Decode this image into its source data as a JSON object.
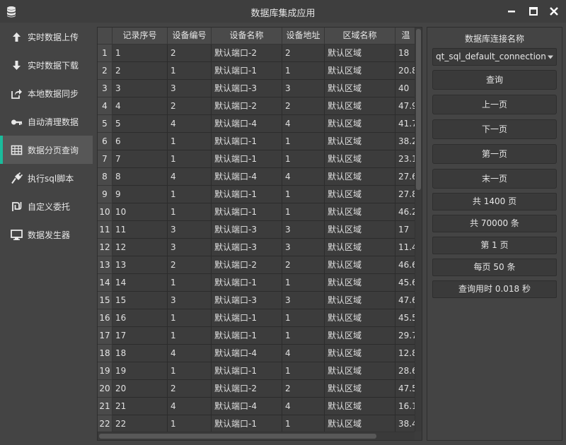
{
  "window": {
    "title": "数据库集成应用",
    "app_icon": "database-icon"
  },
  "colors": {
    "accent": "#1abc9c",
    "background": "#444444",
    "cell": "#3c3c3c",
    "header": "#4a4a4a"
  },
  "sidebar": {
    "items": [
      {
        "label": "实时数据上传",
        "icon": "arrow-up-icon"
      },
      {
        "label": "实时数据下载",
        "icon": "arrow-down-icon"
      },
      {
        "label": "本地数据同步",
        "icon": "share-icon"
      },
      {
        "label": "自动清理数据",
        "icon": "key-icon"
      },
      {
        "label": "数据分页查询",
        "icon": "table-icon",
        "active": true
      },
      {
        "label": "执行sql脚本",
        "icon": "plug-icon"
      },
      {
        "label": "自定义委托",
        "icon": "shekel-icon"
      },
      {
        "label": "数据发生器",
        "icon": "monitor-icon"
      }
    ]
  },
  "table": {
    "columns": [
      "记录序号",
      "设备编号",
      "设备名称",
      "设备地址",
      "区域名称",
      "温"
    ],
    "rows": [
      [
        "1",
        "1",
        "2",
        "默认端口-2",
        "2",
        "默认区域",
        "18"
      ],
      [
        "2",
        "2",
        "1",
        "默认端口-1",
        "1",
        "默认区域",
        "20.8"
      ],
      [
        "3",
        "3",
        "3",
        "默认端口-3",
        "3",
        "默认区域",
        "40"
      ],
      [
        "4",
        "4",
        "2",
        "默认端口-2",
        "2",
        "默认区域",
        "47.9"
      ],
      [
        "5",
        "5",
        "4",
        "默认端口-4",
        "4",
        "默认区域",
        "41.7"
      ],
      [
        "6",
        "6",
        "1",
        "默认端口-1",
        "1",
        "默认区域",
        "38.2"
      ],
      [
        "7",
        "7",
        "1",
        "默认端口-1",
        "1",
        "默认区域",
        "23.1"
      ],
      [
        "8",
        "8",
        "4",
        "默认端口-4",
        "4",
        "默认区域",
        "27.6"
      ],
      [
        "9",
        "9",
        "1",
        "默认端口-1",
        "1",
        "默认区域",
        "27.8"
      ],
      [
        "10",
        "10",
        "1",
        "默认端口-1",
        "1",
        "默认区域",
        "46.2"
      ],
      [
        "11",
        "11",
        "3",
        "默认端口-3",
        "3",
        "默认区域",
        "17"
      ],
      [
        "12",
        "12",
        "3",
        "默认端口-3",
        "3",
        "默认区域",
        "11.4"
      ],
      [
        "13",
        "13",
        "2",
        "默认端口-2",
        "2",
        "默认区域",
        "46.6"
      ],
      [
        "14",
        "14",
        "1",
        "默认端口-1",
        "1",
        "默认区域",
        "45.6"
      ],
      [
        "15",
        "15",
        "3",
        "默认端口-3",
        "3",
        "默认区域",
        "47.6"
      ],
      [
        "16",
        "16",
        "1",
        "默认端口-1",
        "1",
        "默认区域",
        "45.5"
      ],
      [
        "17",
        "17",
        "1",
        "默认端口-1",
        "1",
        "默认区域",
        "29.7"
      ],
      [
        "18",
        "18",
        "4",
        "默认端口-4",
        "4",
        "默认区域",
        "12.8"
      ],
      [
        "19",
        "19",
        "1",
        "默认端口-1",
        "1",
        "默认区域",
        "28.6"
      ],
      [
        "20",
        "20",
        "2",
        "默认端口-2",
        "2",
        "默认区域",
        "47.5"
      ],
      [
        "21",
        "21",
        "4",
        "默认端口-4",
        "4",
        "默认区域",
        "16.1"
      ],
      [
        "22",
        "22",
        "1",
        "默认端口-1",
        "1",
        "默认区域",
        "38.4"
      ]
    ]
  },
  "panel": {
    "connection_label": "数据库连接名称",
    "connection_value": "qt_sql_default_connection",
    "buttons": [
      "查询",
      "上一页",
      "下一页",
      "第一页",
      "末一页"
    ],
    "info": [
      "共 1400 页",
      "共 70000 条",
      "第 1 页",
      "每页 50 条",
      "查询用时 0.018 秒"
    ]
  }
}
